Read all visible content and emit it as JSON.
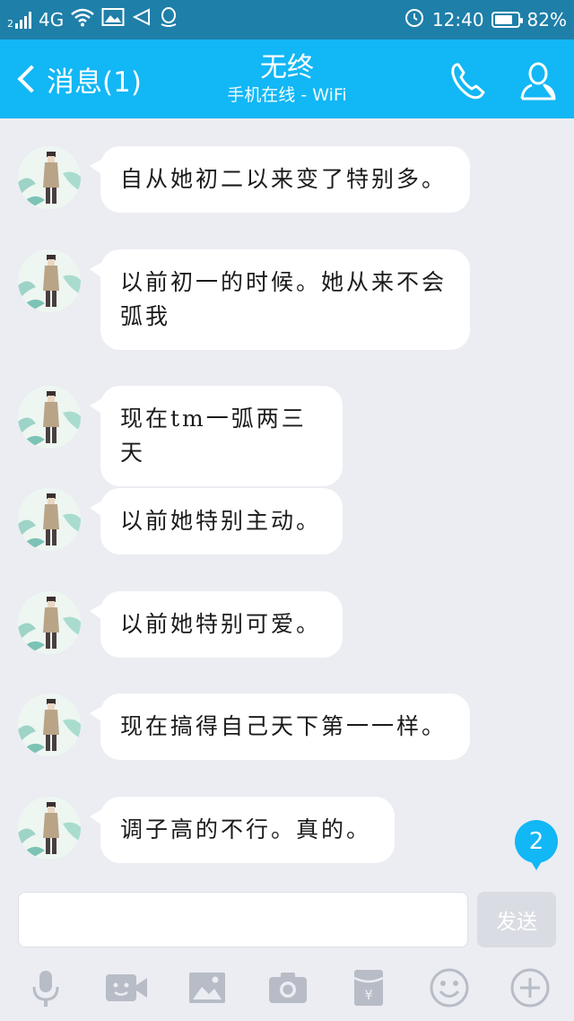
{
  "status_bar": {
    "sim_slot": "2",
    "network": "4G",
    "time": "12:40",
    "battery_percent": "82%",
    "battery_level": 0.82
  },
  "header": {
    "back_label": "消息(1)",
    "title": "无终",
    "subtitle": "手机在线 - WiFi",
    "background_color": "#12b7f5"
  },
  "messages": [
    {
      "text": "自从她初二以来变了特别多。"
    },
    {
      "text": "以前初一的时候。她从来不会\n弧我"
    },
    {
      "text": "现在tm一弧两三天"
    },
    {
      "text": "以前她特别主动。"
    },
    {
      "text": "以前她特别可爱。"
    },
    {
      "text": "现在搞得自己天下第一一样。"
    },
    {
      "text": "调子高的不行。真的。"
    }
  ],
  "unread_count": "2",
  "input": {
    "value": "",
    "placeholder": "",
    "send_label": "发送"
  },
  "toolbar_icons": [
    "microphone-icon",
    "video-icon",
    "image-icon",
    "camera-icon",
    "red-envelope-icon",
    "emoji-icon",
    "plus-icon"
  ]
}
